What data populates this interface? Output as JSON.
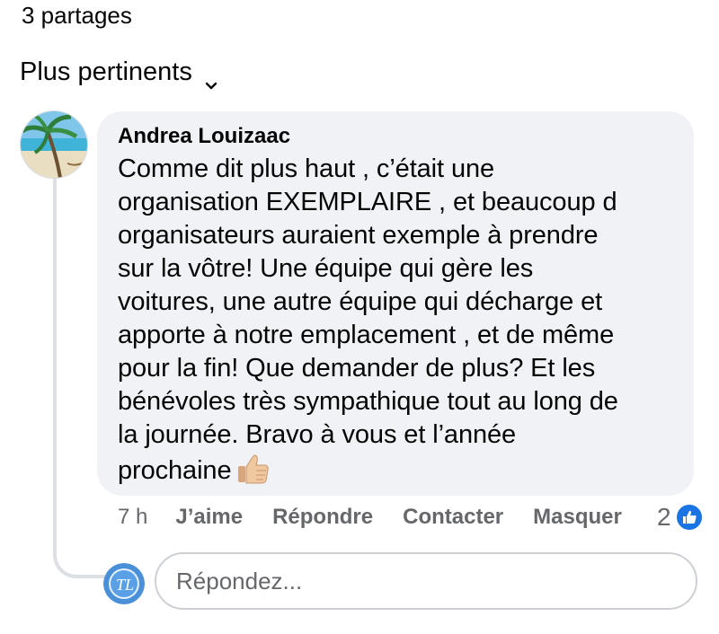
{
  "header": {
    "shares": "3 partages",
    "sort_label": "Plus pertinents"
  },
  "comment": {
    "author": "Andrea Louizaac",
    "lines": [
      "Comme dit plus haut , c’était une",
      "organisation EXEMPLAIRE , et beaucoup d",
      "organisateurs auraient exemple à prendre",
      "sur la vôtre! Une équipe qui gère les",
      "voitures, une autre équipe qui décharge et",
      "apporte à notre emplacement , et de même",
      "pour la fin! Que demander de plus? Et les",
      "bénévoles très sympathique tout au long de",
      "la journée. Bravo à vous et l’année",
      "prochaine"
    ],
    "emoji": "thumbs-up-emoji",
    "time": "7 h",
    "actions": {
      "like": "J’aime",
      "reply": "Répondre",
      "contact": "Contacter",
      "hide": "Masquer"
    },
    "reaction_count": "2",
    "reaction_icon": "like-icon"
  },
  "reply_box": {
    "placeholder": "Répondez..."
  },
  "colors": {
    "bubble": "#f0f2f5",
    "secondary_text": "#65676b",
    "like_blue": "#1b74e4"
  }
}
